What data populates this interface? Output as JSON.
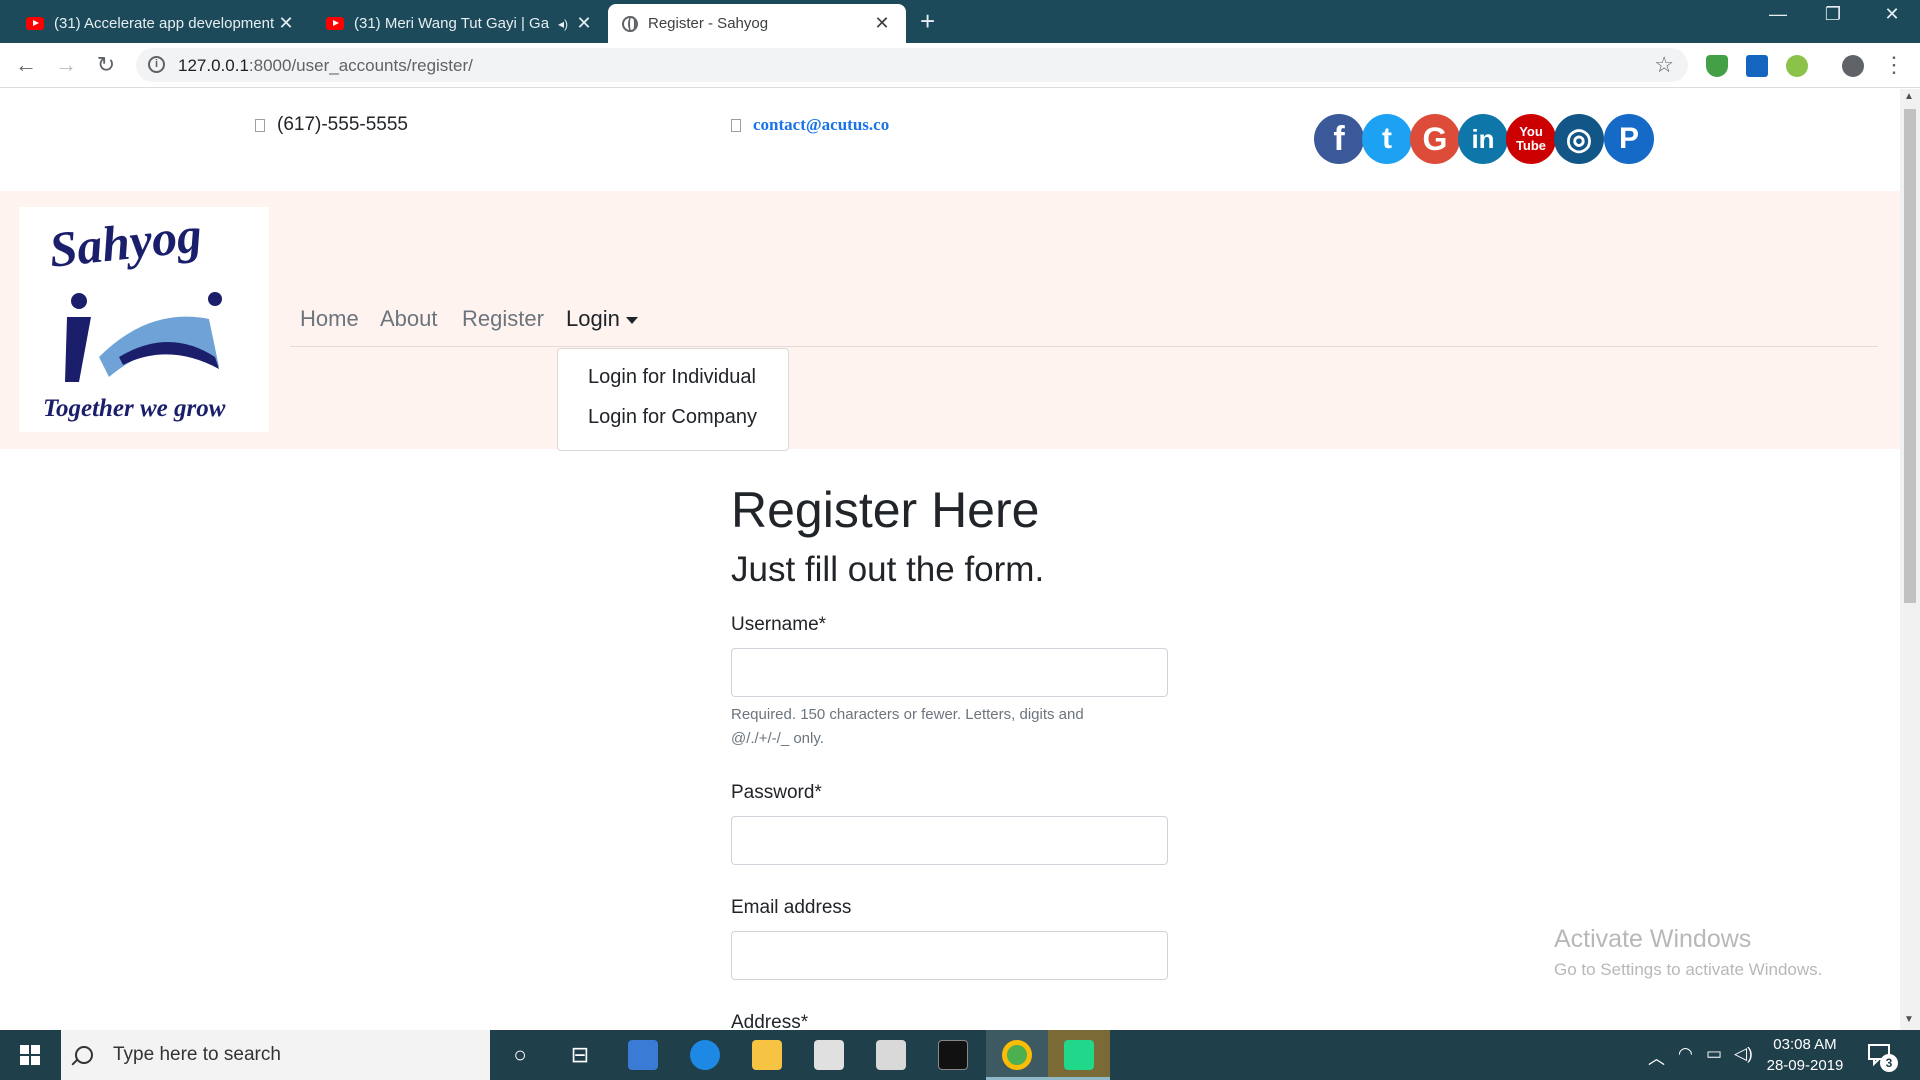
{
  "browser": {
    "tabs": [
      {
        "title": "(31) Accelerate app development",
        "favicon": "youtube-icon",
        "active": false
      },
      {
        "title": "(31) Meri Wang Tut Gayi | Ga",
        "favicon": "youtube-icon",
        "active": false
      },
      {
        "title": "Register - Sahyog",
        "favicon": "globe-icon",
        "active": true
      }
    ],
    "new_tab_glyph": "+",
    "url_host": "127.0.0.1",
    "url_path": ":8000/user_accounts/register/"
  },
  "site": {
    "phone": "(617)-555-5555",
    "email": "contact@acutus.co",
    "social": [
      {
        "name": "facebook",
        "glyph": "f",
        "color": "#3b5998"
      },
      {
        "name": "twitter",
        "glyph": "t",
        "color": "#1da1f2"
      },
      {
        "name": "google",
        "glyph": "G",
        "color": "#dd4b39"
      },
      {
        "name": "linkedin",
        "glyph": "in",
        "color": "#0e76a8"
      },
      {
        "name": "youtube",
        "glyph": "You Tube",
        "color": "#cc0000"
      },
      {
        "name": "instagram",
        "glyph": "◎",
        "color": "#125688"
      },
      {
        "name": "pinterest",
        "glyph": "P",
        "color": "#1569c7"
      }
    ],
    "logo": {
      "brand": "Sahyog",
      "tagline": "Together we grow"
    },
    "nav": {
      "home": "Home",
      "about": "About",
      "register": "Register",
      "login": "Login"
    },
    "login_menu": {
      "individual": "Login for Individual",
      "company": "Login for Company"
    }
  },
  "form": {
    "title": "Register Here",
    "subtitle": "Just fill out the form.",
    "username_label": "Username*",
    "username_value": "",
    "username_help": "Required. 150 characters or fewer. Letters, digits and @/./+/-/_ only.",
    "password_label": "Password*",
    "password_value": "",
    "email_label": "Email address",
    "email_value": "",
    "address_label": "Address*"
  },
  "watermark": {
    "title": "Activate Windows",
    "subtitle": "Go to Settings to activate Windows."
  },
  "taskbar": {
    "search_placeholder": "Type here to search",
    "time": "03:08 AM",
    "date": "28-09-2019",
    "notification_count": "3"
  }
}
